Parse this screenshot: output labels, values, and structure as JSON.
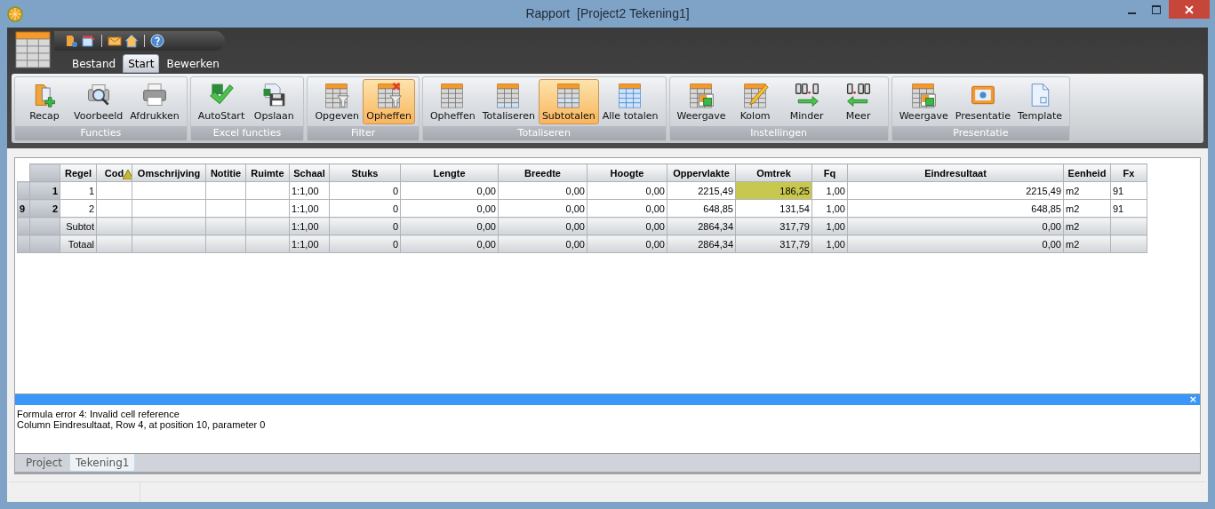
{
  "window": {
    "title": "Rapport  [Project2 Tekening1]"
  },
  "ribbon_tabs": [
    {
      "label": "Bestand",
      "selected": false
    },
    {
      "label": "Start",
      "selected": true
    },
    {
      "label": "Bewerken",
      "selected": false
    }
  ],
  "ribbon_groups": [
    {
      "title": "Functies",
      "buttons": [
        {
          "label": "Recap",
          "selected": false
        },
        {
          "label": "Voorbeeld",
          "selected": false
        },
        {
          "label": "Afdrukken",
          "selected": false
        }
      ]
    },
    {
      "title": "Excel functies",
      "buttons": [
        {
          "label": "AutoStart",
          "selected": false
        },
        {
          "label": "Opslaan",
          "selected": false
        }
      ]
    },
    {
      "title": "Filter",
      "buttons": [
        {
          "label": "Opgeven",
          "selected": false
        },
        {
          "label": "Opheffen",
          "selected": true
        }
      ]
    },
    {
      "title": "Totaliseren",
      "buttons": [
        {
          "label": "Opheffen",
          "selected": false
        },
        {
          "label": "Totaliseren",
          "selected": false
        },
        {
          "label": "Subtotalen",
          "selected": true
        },
        {
          "label": "Alle totalen",
          "selected": false
        }
      ]
    },
    {
      "title": "Instellingen",
      "buttons": [
        {
          "label": "Weergave",
          "selected": false
        },
        {
          "label": "Kolom",
          "selected": false
        },
        {
          "label": "Minder",
          "selected": false
        },
        {
          "label": "Meer",
          "selected": false
        }
      ]
    },
    {
      "title": "Presentatie",
      "buttons": [
        {
          "label": "Weergave",
          "selected": false
        },
        {
          "label": "Presentatie",
          "selected": false
        },
        {
          "label": "Template",
          "selected": false
        }
      ]
    }
  ],
  "table": {
    "columns": [
      {
        "label": "Regel"
      },
      {
        "label": "Cod",
        "warning": true
      },
      {
        "label": "Omschrijving"
      },
      {
        "label": "Notitie"
      },
      {
        "label": "Ruimte"
      },
      {
        "label": "Schaal"
      },
      {
        "label": "Stuks"
      },
      {
        "label": "Lengte"
      },
      {
        "label": "Breedte"
      },
      {
        "label": "Hoogte"
      },
      {
        "label": "Oppervlakte"
      },
      {
        "label": "Omtrek"
      },
      {
        "label": "Fq"
      },
      {
        "label": "Eindresultaat"
      },
      {
        "label": "Eenheid"
      },
      {
        "label": "Fx"
      }
    ],
    "rows": [
      {
        "kind": "data",
        "marker": "",
        "number": "1",
        "cells": [
          "1",
          "",
          "",
          "",
          "",
          "1:1,00",
          "0",
          "0,00",
          "0,00",
          "0,00",
          "2215,49",
          {
            "text": "186,25",
            "color": "#c8c850"
          },
          "1,00",
          "2215,49",
          "m2",
          "91"
        ]
      },
      {
        "kind": "data",
        "marker": "9",
        "number": "2",
        "cells": [
          "2",
          "",
          "",
          "",
          "",
          "1:1,00",
          "0",
          "0,00",
          "0,00",
          "0,00",
          "648,85",
          "131,54",
          "1,00",
          "648,85",
          "m2",
          "91"
        ]
      },
      {
        "kind": "total",
        "marker": "",
        "number": "",
        "cells": [
          "Subtot",
          "",
          "",
          "",
          "",
          "1:1,00",
          "0",
          "0,00",
          "0,00",
          "0,00",
          "2864,34",
          "317,79",
          "1,00",
          "0,00",
          "m2",
          ""
        ]
      },
      {
        "kind": "total",
        "marker": "",
        "number": "",
        "cells": [
          "Totaal",
          "",
          "",
          "",
          "",
          "1:1,00",
          "0",
          "0,00",
          "0,00",
          "0,00",
          "2864,34",
          "317,79",
          "1,00",
          "0,00",
          "m2",
          ""
        ]
      }
    ]
  },
  "message_panel": {
    "close": "×",
    "lines": [
      "Formula error 4: Invalid cell reference",
      "Column Eindresultaat, Row 4, at position 10, parameter 0"
    ]
  },
  "document_tabs": [
    {
      "label": "Project",
      "selected": false
    },
    {
      "label": "Tekening1",
      "selected": true
    }
  ]
}
